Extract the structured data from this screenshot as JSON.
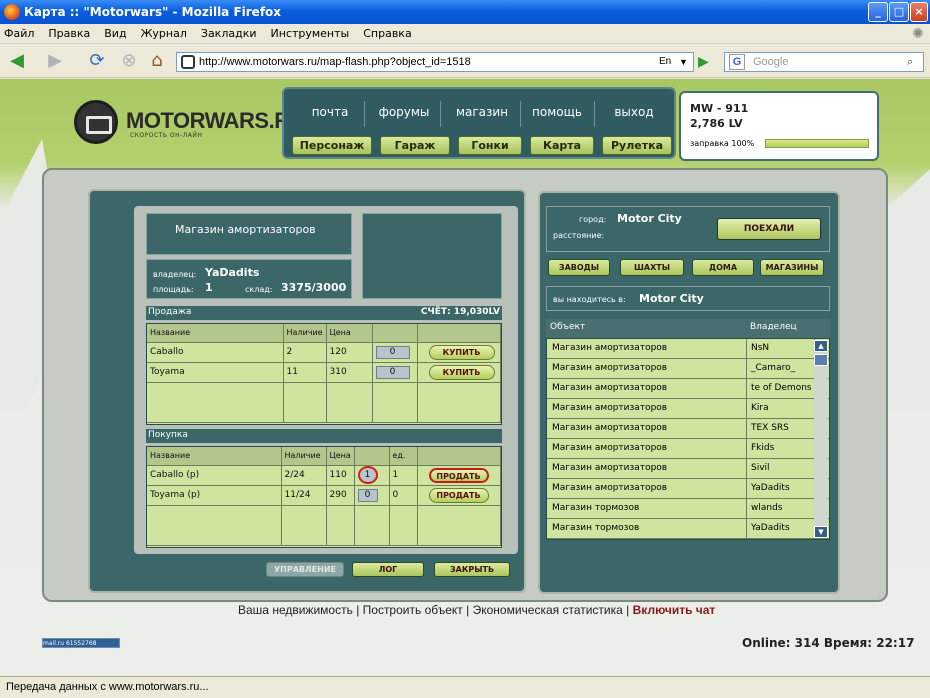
{
  "browser": {
    "title": "Карта :: \"Motorwars\" - Mozilla Firefox",
    "menu": [
      "Файл",
      "Правка",
      "Вид",
      "Журнал",
      "Закладки",
      "Инструменты",
      "Справка"
    ],
    "url": "http://www.motorwars.ru/map-flash.php?object_id=1518",
    "lang": "En",
    "search_engine": "G",
    "search_placeholder": "Google",
    "status": "Передача данных с www.motorwars.ru..."
  },
  "site": {
    "logo": "MOTORWARS.RU",
    "logo_sub": "СКОРОСТЬ ОН-ЛАЙН",
    "top_links": [
      "почта",
      "форумы",
      "магазин",
      "помощь",
      "выход"
    ],
    "nav_buttons": [
      "Персонаж",
      "Гараж",
      "Гонки",
      "Карта",
      "Рулетка"
    ],
    "player": {
      "car": "MW - 911",
      "money": "2,786 LV",
      "fuel_label": "заправка 100%",
      "fuel": 1.0
    }
  },
  "shop": {
    "title": "Магазин амортизаторов",
    "owner_label": "владелец:",
    "owner": "YaDadits",
    "area_label": "площадь:",
    "area": "1",
    "stock_label": "склад:",
    "stock": "3375/3000",
    "sale_title": "Продажа",
    "account": "СЧЁТ: 19,030LV",
    "sale_headers": [
      "Название",
      "Наличие",
      "Цена",
      "",
      ""
    ],
    "sale_rows": [
      {
        "name": "Caballo",
        "avail": "2",
        "price": "120",
        "qty": "0",
        "button": "КУПИТЬ"
      },
      {
        "name": "Toyama",
        "avail": "11",
        "price": "310",
        "qty": "0",
        "button": "КУПИТЬ"
      }
    ],
    "buy_title": "Покупка",
    "buy_headers": [
      "Название",
      "Наличие",
      "Цена",
      "",
      "ед.",
      ""
    ],
    "buy_rows": [
      {
        "name": "Caballo (p)",
        "avail": "2/24",
        "price": "110",
        "qty": "1",
        "unit": "1",
        "button": "ПРОДАТЬ"
      },
      {
        "name": "Toyama (p)",
        "avail": "11/24",
        "price": "290",
        "qty": "0",
        "unit": "0",
        "button": "ПРОДАТЬ"
      }
    ],
    "bottom_buttons": [
      "УПРАВЛЕНИЕ",
      "ЛОГ",
      "ЗАКРЫТЬ"
    ]
  },
  "city": {
    "city_label": "город:",
    "city": "Motor City",
    "distance_label": "расстояние:",
    "go_button": "ПОЕХАЛИ",
    "categories": [
      "ЗАВОДЫ",
      "ШАХТЫ",
      "ДОМА",
      "МАГАЗИНЫ"
    ],
    "location_label": "вы находитесь в:",
    "location": "Motor City",
    "list_headers": [
      "Объект",
      "Владелец"
    ],
    "objects": [
      {
        "name": "Магазин амортизаторов",
        "owner": "NsN"
      },
      {
        "name": "Магазин амортизаторов",
        "owner": "_Camaro_"
      },
      {
        "name": "Магазин амортизаторов",
        "owner": "te of Demons"
      },
      {
        "name": "Магазин амортизаторов",
        "owner": "Kira"
      },
      {
        "name": "Магазин амортизаторов",
        "owner": "TEX SRS"
      },
      {
        "name": "Магазин амортизаторов",
        "owner": "Fkids"
      },
      {
        "name": "Магазин амортизаторов",
        "owner": "Sivil"
      },
      {
        "name": "Магазин амортизаторов",
        "owner": "YaDadits"
      },
      {
        "name": "Магазин тормозов",
        "owner": "wlands"
      },
      {
        "name": "Магазин тормозов",
        "owner": "YaDadits"
      }
    ]
  },
  "footer": {
    "links": [
      "Ваша недвижимость",
      "Построить объект",
      "Экономическая статистика",
      "Включить чат"
    ],
    "counter": "mail.ru 61552768",
    "online": "Online: 314  Время: 22:17"
  }
}
